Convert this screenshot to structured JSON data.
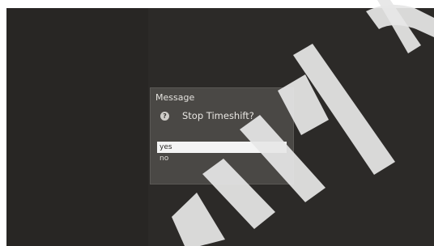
{
  "dialog": {
    "title": "Message",
    "question_icon": "question-icon",
    "question": "Stop Timeshift?",
    "options": [
      {
        "label": "yes",
        "selected": true
      },
      {
        "label": "no",
        "selected": false
      }
    ]
  },
  "watermark": {
    "text": "MMLC"
  },
  "colors": {
    "screen_bg": "#282624",
    "dialog_bg": "#4a4845",
    "selected_bg": "#f4f4f4",
    "watermark": "#e6e6e6"
  }
}
